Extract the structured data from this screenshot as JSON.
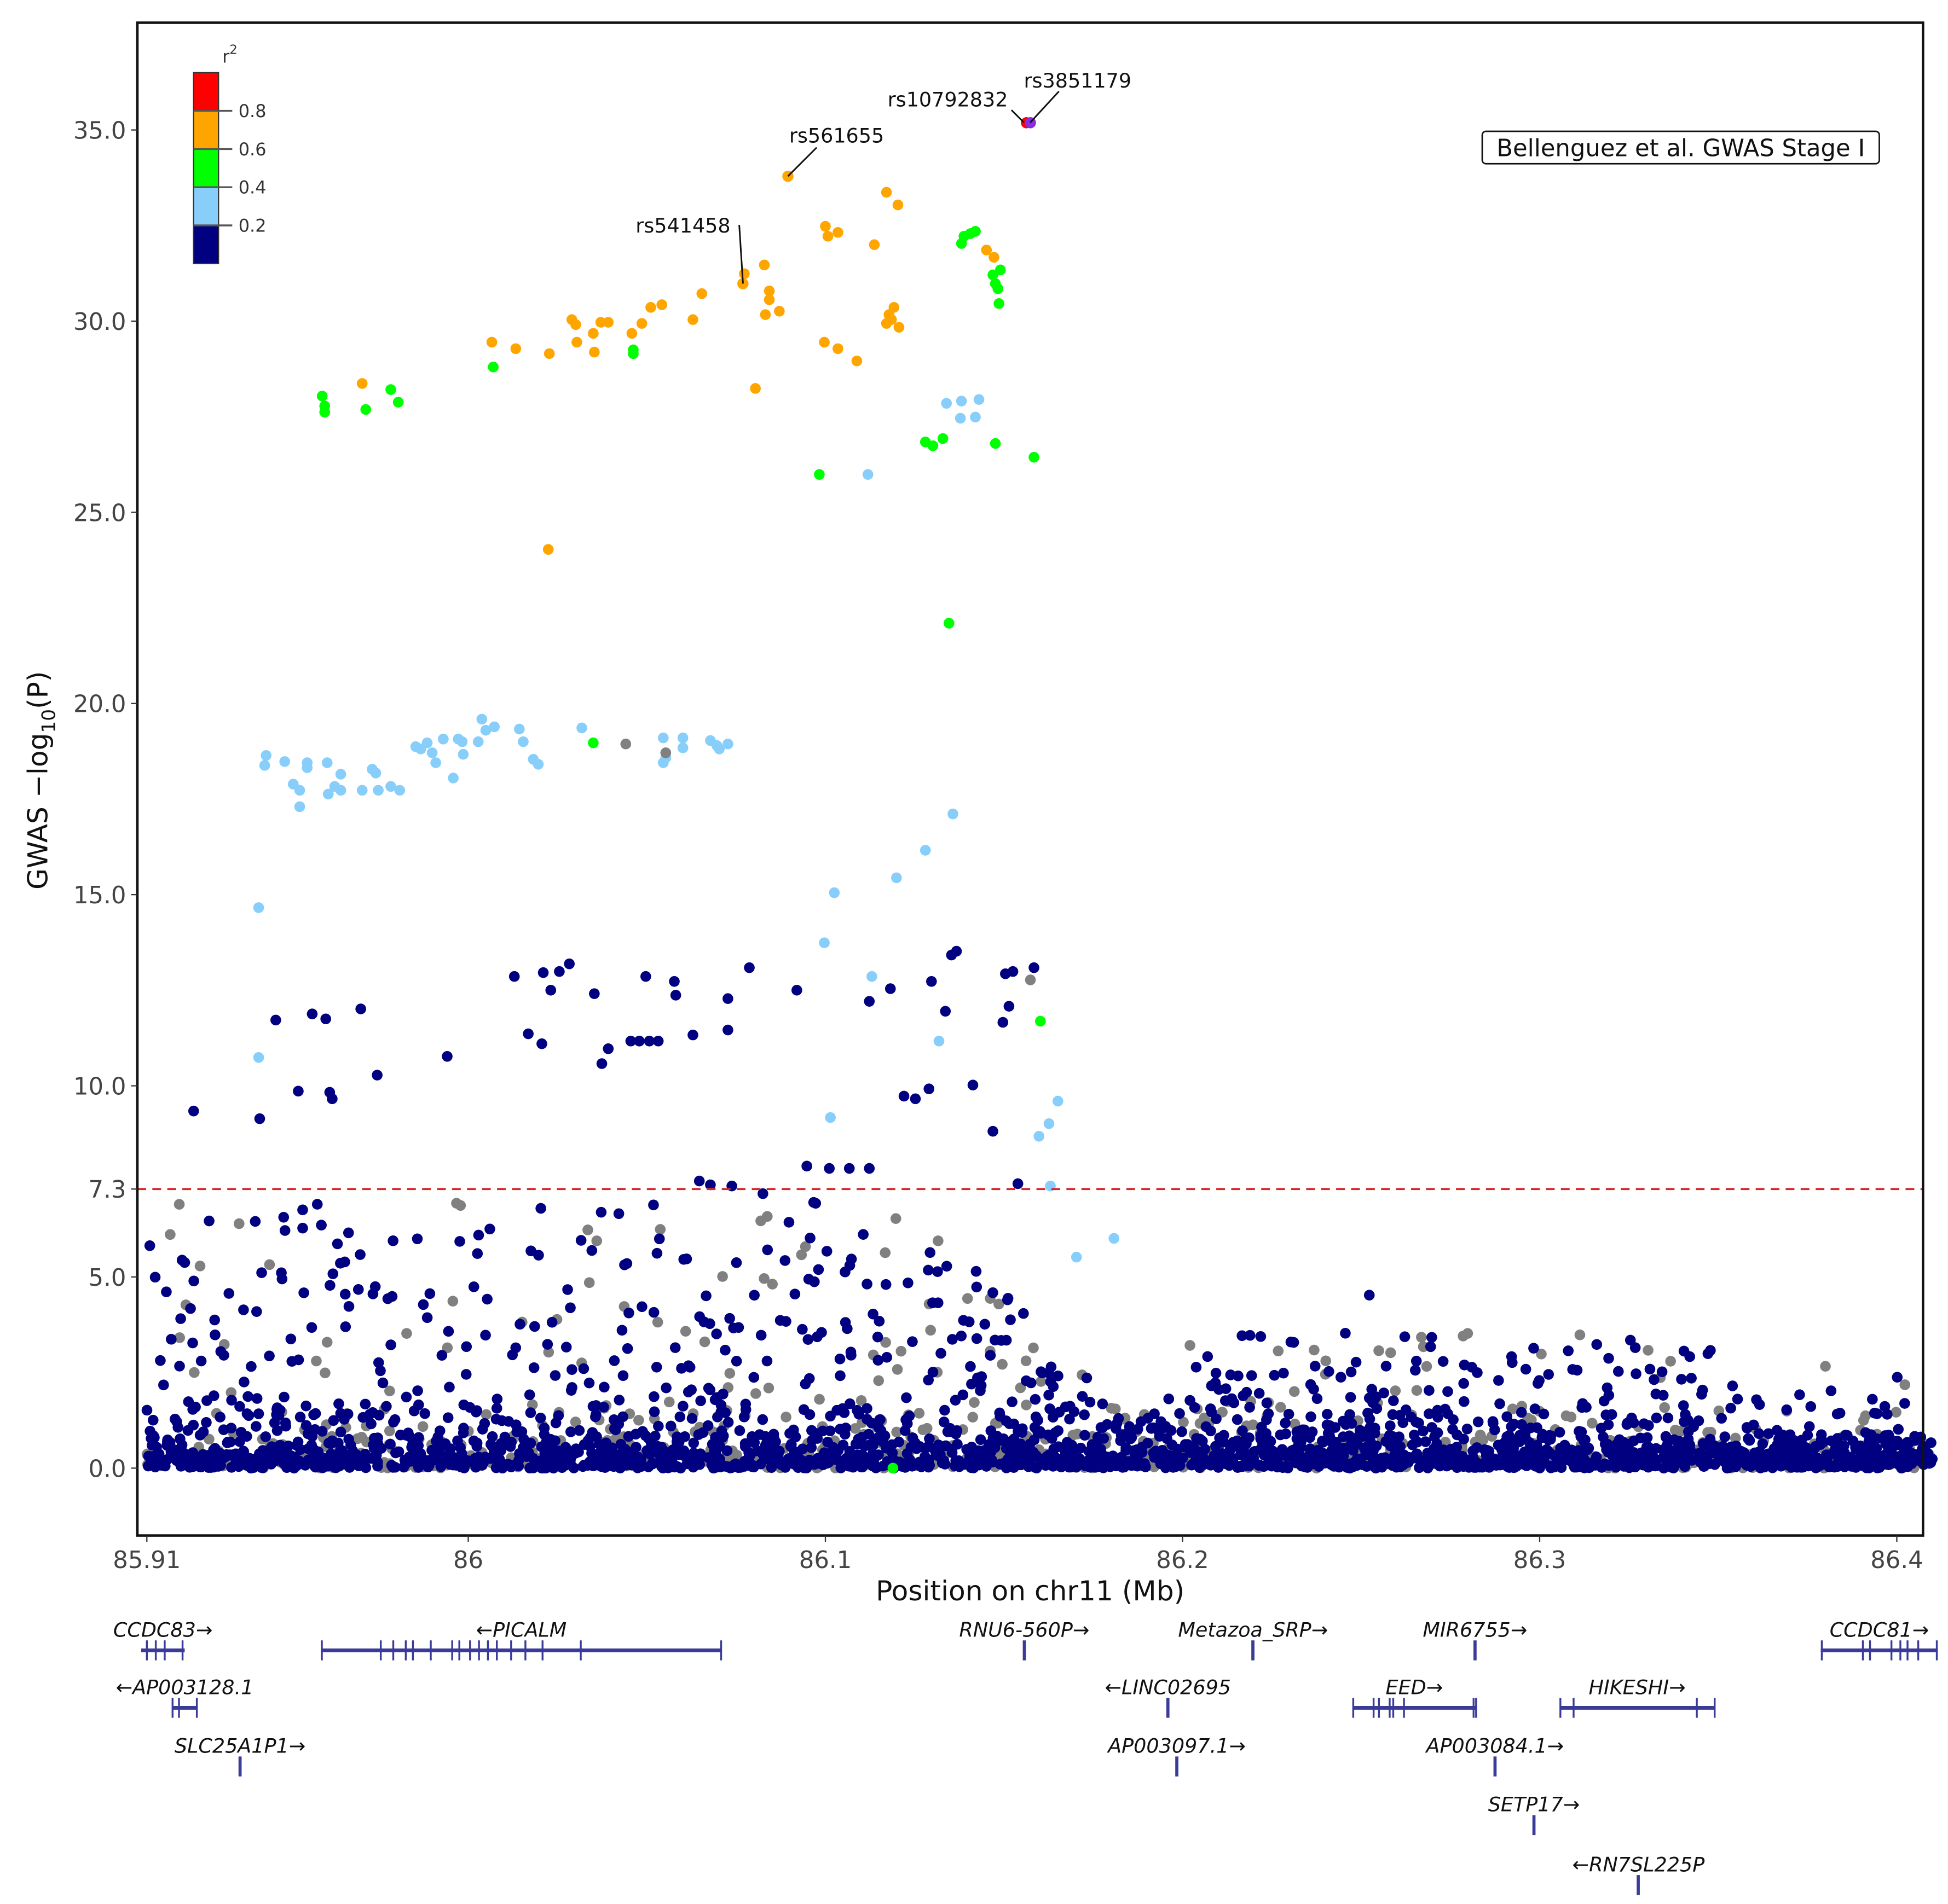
{
  "chart_data": {
    "type": "scatter",
    "title": "",
    "xlabel": "Position on chr11 (Mb)",
    "ylabel": "GWAS −log10(P)",
    "ylabel_parts": {
      "main": "GWAS −log",
      "sub": "10",
      "tail": "(P)"
    },
    "xlim": [
      85.91,
      86.41
    ],
    "ylim": [
      -1.8,
      37.8
    ],
    "xticks": [
      "85.91",
      "86",
      "86.1",
      "86.2",
      "86.3",
      "86.4"
    ],
    "xtick_values": [
      85.91,
      86.0,
      86.1,
      86.2,
      86.3,
      86.4
    ],
    "yticks": [
      "0.0",
      "5.0",
      "7.3",
      "10.0",
      "15.0",
      "20.0",
      "25.0",
      "30.0",
      "35.0"
    ],
    "ytick_values": [
      0,
      5,
      7.3,
      10,
      15,
      20,
      25,
      30,
      35
    ],
    "threshold": {
      "value": 7.3,
      "color": "#d62728"
    },
    "annotation_box": "Bellenguez et al. GWAS Stage I",
    "legend": {
      "title": "r",
      "title_sup": "2",
      "placement": "top-left",
      "bins": [
        {
          "color": "#000080"
        },
        {
          "color": "#87cefa"
        },
        {
          "color": "#00ff00"
        },
        {
          "color": "#ffa500"
        },
        {
          "color": "#ff0000"
        }
      ],
      "tick_labels": [
        "0.2",
        "0.4",
        "0.6",
        "0.8"
      ]
    },
    "colors": {
      "0": "#000080",
      "1": "#87cefa",
      "2": "#00ff00",
      "3": "#ffa500",
      "4": "#ff0000",
      "lead": "#8a2be2",
      "na": "#808080"
    },
    "labeled_snps": [
      {
        "name": "rs3851179",
        "x": 86.1574,
        "y": 35.19,
        "color_key": "lead"
      },
      {
        "name": "rs10792832",
        "x": 86.1563,
        "y": 35.19,
        "color_key": "4"
      },
      {
        "name": "rs561655",
        "x": 86.0895,
        "y": 33.79,
        "color_key": "3"
      },
      {
        "name": "rs541458",
        "x": 86.0769,
        "y": 30.98,
        "color_key": "3"
      }
    ],
    "points": [
      [
        86.1171,
        33.37,
        "3"
      ],
      [
        86.1203,
        33.04,
        "3"
      ],
      [
        86.1,
        32.48,
        "3"
      ],
      [
        86.1007,
        32.22,
        "3"
      ],
      [
        86.1035,
        32.32,
        "3"
      ],
      [
        86.1137,
        32.0,
        "3"
      ],
      [
        86.0773,
        31.24,
        "3"
      ],
      [
        86.0829,
        31.47,
        "3"
      ],
      [
        86.0843,
        30.79,
        "3"
      ],
      [
        86.0843,
        30.56,
        "3"
      ],
      [
        86.0832,
        30.17,
        "3"
      ],
      [
        86.0871,
        30.26,
        "3"
      ],
      [
        86.0654,
        30.72,
        "3"
      ],
      [
        86.0542,
        30.43,
        "3"
      ],
      [
        86.0511,
        30.36,
        "3"
      ],
      [
        86.0629,
        30.04,
        "3"
      ],
      [
        86.0486,
        29.94,
        "3"
      ],
      [
        86.0458,
        29.68,
        "3"
      ],
      [
        86.0392,
        29.97,
        "3"
      ],
      [
        86.0371,
        29.97,
        "3"
      ],
      [
        86.029,
        30.04,
        "3"
      ],
      [
        86.0301,
        29.91,
        "3"
      ],
      [
        86.035,
        29.68,
        "3"
      ],
      [
        86.0304,
        29.45,
        "3"
      ],
      [
        86.0353,
        29.19,
        "3"
      ],
      [
        86.0227,
        29.15,
        "3"
      ],
      [
        86.0133,
        29.28,
        "3"
      ],
      [
        86.0066,
        29.45,
        "3"
      ],
      [
        85.9703,
        28.37,
        "3"
      ],
      [
        86.0804,
        28.24,
        "3"
      ],
      [
        86.0997,
        29.45,
        "3"
      ],
      [
        86.1035,
        29.28,
        "3"
      ],
      [
        86.1088,
        28.96,
        "3"
      ],
      [
        86.1178,
        30.17,
        "3"
      ],
      [
        86.1192,
        30.36,
        "3"
      ],
      [
        86.1171,
        29.94,
        "3"
      ],
      [
        86.1206,
        29.84,
        "3"
      ],
      [
        86.1185,
        30.04,
        "3"
      ],
      [
        86.1451,
        31.86,
        "3"
      ],
      [
        86.1472,
        31.67,
        "3"
      ],
      [
        86.0224,
        24.03,
        "3"
      ],
      [
        86.1388,
        32.22,
        "2"
      ],
      [
        86.1381,
        32.03,
        "2"
      ],
      [
        86.142,
        32.35,
        "2"
      ],
      [
        86.1406,
        32.29,
        "2"
      ],
      [
        86.1469,
        31.21,
        "2"
      ],
      [
        86.149,
        31.34,
        "2"
      ],
      [
        86.1476,
        30.98,
        "2"
      ],
      [
        86.1483,
        30.85,
        "2"
      ],
      [
        86.1486,
        30.46,
        "2"
      ],
      [
        86.007,
        28.8,
        "2"
      ],
      [
        86.0462,
        29.25,
        "2"
      ],
      [
        86.0462,
        29.15,
        "2"
      ],
      [
        85.9591,
        28.04,
        "2"
      ],
      [
        85.9598,
        27.78,
        "2"
      ],
      [
        85.9598,
        27.62,
        "2"
      ],
      [
        85.9713,
        27.69,
        "2"
      ],
      [
        85.9783,
        28.21,
        "2"
      ],
      [
        85.9804,
        27.88,
        "2"
      ],
      [
        86.0983,
        25.99,
        "2"
      ],
      [
        86.128,
        26.84,
        "2"
      ],
      [
        86.1301,
        26.74,
        "2"
      ],
      [
        86.1329,
        26.93,
        "2"
      ],
      [
        86.1476,
        26.8,
        "2"
      ],
      [
        86.1584,
        26.44,
        "2"
      ],
      [
        86.1346,
        22.1,
        "2"
      ],
      [
        86.035,
        18.97,
        "2"
      ],
      [
        86.1602,
        11.69,
        "2"
      ],
      [
        86.1189,
        0.0,
        "2"
      ],
      [
        86.1119,
        25.99,
        "1"
      ],
      [
        86.1339,
        27.85,
        "1"
      ],
      [
        86.1381,
        27.91,
        "1"
      ],
      [
        86.143,
        27.95,
        "1"
      ],
      [
        86.1378,
        27.46,
        "1"
      ],
      [
        86.142,
        27.49,
        "1"
      ],
      [
        86.1357,
        17.11,
        "1"
      ],
      [
        86.128,
        16.16,
        "1"
      ],
      [
        86.1199,
        15.44,
        "1"
      ],
      [
        86.1025,
        15.05,
        "1"
      ],
      [
        86.0997,
        13.74,
        "1"
      ],
      [
        86.113,
        12.86,
        "1"
      ],
      [
        86.1318,
        11.17,
        "1"
      ],
      [
        86.1014,
        9.17,
        "1"
      ],
      [
        85.9413,
        14.66,
        "1"
      ],
      [
        85.9413,
        10.74,
        "1"
      ],
      [
        86.1651,
        9.6,
        "1"
      ],
      [
        86.1626,
        9.01,
        "1"
      ],
      [
        86.1598,
        8.68,
        "1"
      ],
      [
        86.163,
        7.38,
        "1"
      ],
      [
        86.1808,
        6.01,
        "1"
      ],
      [
        86.1703,
        5.52,
        "1"
      ],
      [
        85.943,
        18.38,
        "1"
      ],
      [
        85.9434,
        18.64,
        "1"
      ],
      [
        85.9486,
        18.48,
        "1"
      ],
      [
        85.951,
        17.89,
        "1"
      ],
      [
        85.9528,
        17.73,
        "1"
      ],
      [
        85.9528,
        17.3,
        "1"
      ],
      [
        85.9549,
        18.45,
        "1"
      ],
      [
        85.9549,
        18.32,
        "1"
      ],
      [
        85.9605,
        18.45,
        "1"
      ],
      [
        85.9608,
        17.63,
        "1"
      ],
      [
        85.9626,
        17.83,
        "1"
      ],
      [
        85.9643,
        18.15,
        "1"
      ],
      [
        85.9643,
        17.73,
        "1"
      ],
      [
        85.9703,
        17.73,
        "1"
      ],
      [
        85.9731,
        18.28,
        "1"
      ],
      [
        85.9741,
        18.18,
        "1"
      ],
      [
        85.9748,
        17.73,
        "1"
      ],
      [
        85.9783,
        17.83,
        "1"
      ],
      [
        85.9808,
        17.73,
        "1"
      ],
      [
        85.9853,
        18.87,
        "1"
      ],
      [
        85.9867,
        18.81,
        "1"
      ],
      [
        85.9885,
        18.97,
        "1"
      ],
      [
        85.9899,
        18.71,
        "1"
      ],
      [
        85.9909,
        18.45,
        "1"
      ],
      [
        85.993,
        19.07,
        "1"
      ],
      [
        85.9958,
        18.05,
        "1"
      ],
      [
        85.9972,
        19.07,
        "1"
      ],
      [
        85.9983,
        19.0,
        "1"
      ],
      [
        85.9986,
        18.67,
        "1"
      ],
      [
        86.0028,
        19.0,
        "1"
      ],
      [
        86.0038,
        19.59,
        "1"
      ],
      [
        86.0049,
        19.3,
        "1"
      ],
      [
        86.0073,
        19.39,
        "1"
      ],
      [
        86.0143,
        19.33,
        "1"
      ],
      [
        86.0154,
        19.0,
        "1"
      ],
      [
        86.0182,
        18.54,
        "1"
      ],
      [
        86.0196,
        18.41,
        "1"
      ],
      [
        86.0318,
        19.36,
        "1"
      ],
      [
        86.0546,
        19.1,
        "1"
      ],
      [
        86.0553,
        18.58,
        "1"
      ],
      [
        86.0546,
        18.45,
        "1"
      ],
      [
        86.0601,
        19.1,
        "1"
      ],
      [
        86.0601,
        18.84,
        "1"
      ],
      [
        86.0678,
        19.03,
        "1"
      ],
      [
        86.0696,
        18.9,
        "1"
      ],
      [
        86.0703,
        18.81,
        "1"
      ],
      [
        86.0727,
        18.94,
        "1"
      ],
      [
        86.0441,
        18.94,
        "na"
      ],
      [
        86.0553,
        18.71,
        "na"
      ],
      [
        86.1574,
        12.77,
        "na"
      ],
      [
        85.9231,
        9.34,
        "0"
      ],
      [
        85.9416,
        9.14,
        "0"
      ],
      [
        85.9461,
        11.72,
        "0"
      ],
      [
        85.9563,
        11.88,
        "0"
      ],
      [
        85.9601,
        11.75,
        "0"
      ],
      [
        85.9524,
        9.86,
        "0"
      ],
      [
        85.9612,
        9.83,
        "0"
      ],
      [
        85.9619,
        9.66,
        "0"
      ],
      [
        85.9699,
        12.01,
        "0"
      ],
      [
        85.9745,
        10.28,
        "0"
      ],
      [
        85.9941,
        10.77,
        "0"
      ],
      [
        86.0129,
        12.86,
        "0"
      ],
      [
        86.0168,
        11.36,
        "0"
      ],
      [
        86.0206,
        11.1,
        "0"
      ],
      [
        86.021,
        12.96,
        "0"
      ],
      [
        86.0231,
        12.5,
        "0"
      ],
      [
        86.0255,
        12.99,
        "0"
      ],
      [
        86.0283,
        13.19,
        "0"
      ],
      [
        86.0353,
        12.41,
        "0"
      ],
      [
        86.0374,
        10.58,
        "0"
      ],
      [
        86.0392,
        10.97,
        "0"
      ],
      [
        86.0455,
        11.17,
        "0"
      ],
      [
        86.0479,
        11.17,
        "0"
      ],
      [
        86.0507,
        11.17,
        "0"
      ],
      [
        86.0532,
        11.17,
        "0"
      ],
      [
        86.0497,
        12.86,
        "0"
      ],
      [
        86.0577,
        12.73,
        "0"
      ],
      [
        86.0581,
        12.37,
        "0"
      ],
      [
        86.0629,
        11.33,
        "0"
      ],
      [
        86.0727,
        12.28,
        "0"
      ],
      [
        86.0727,
        11.46,
        "0"
      ],
      [
        86.0787,
        13.09,
        "0"
      ],
      [
        86.092,
        12.5,
        "0"
      ],
      [
        86.0948,
        7.9,
        "0"
      ],
      [
        86.1011,
        7.84,
        "0"
      ],
      [
        86.1067,
        7.84,
        "0"
      ],
      [
        86.1123,
        7.84,
        "0"
      ],
      [
        86.0647,
        7.51,
        "0"
      ],
      [
        86.0678,
        7.41,
        "0"
      ],
      [
        86.0738,
        7.38,
        "0"
      ],
      [
        86.0825,
        7.18,
        "0"
      ],
      [
        86.1123,
        12.21,
        "0"
      ],
      [
        86.1182,
        12.54,
        "0"
      ],
      [
        86.122,
        9.73,
        "0"
      ],
      [
        86.1252,
        9.66,
        "0"
      ],
      [
        86.129,
        9.92,
        "0"
      ],
      [
        86.1297,
        12.73,
        "0"
      ],
      [
        86.1336,
        11.95,
        "0"
      ],
      [
        86.1353,
        13.42,
        "0"
      ],
      [
        86.1367,
        13.52,
        "0"
      ],
      [
        86.1413,
        10.02,
        "0"
      ],
      [
        86.1469,
        8.81,
        "0"
      ],
      [
        86.1504,
        12.93,
        "0"
      ],
      [
        86.1525,
        12.99,
        "0"
      ],
      [
        86.1514,
        12.08,
        "0"
      ],
      [
        86.1497,
        11.66,
        "0"
      ],
      [
        86.1584,
        13.09,
        "0"
      ],
      [
        86.1539,
        7.44,
        "0"
      ]
    ],
    "background_points": {
      "count": 3200,
      "seed": 11,
      "colors": [
        "0",
        "na"
      ],
      "gray_fraction": 0.22,
      "elevated_region": [
        85.91,
        86.19
      ],
      "elevated_max": 7.0,
      "secondary_region": [
        86.2,
        86.36
      ],
      "secondary_max": 3.6
    }
  },
  "genes": [
    {
      "label": "CCDC83→",
      "start": 85.9084,
      "end": 85.9206,
      "row": 0,
      "exons": [
        85.91,
        85.9125,
        85.915,
        85.92
      ]
    },
    {
      "label": "←PICALM",
      "start": 85.9587,
      "end": 86.071,
      "row": 0,
      "exons": [
        85.959,
        85.9755,
        85.979,
        85.9825,
        85.9845,
        85.9895,
        85.9955,
        85.9975,
        86.0005,
        86.003,
        86.0055,
        86.008,
        86.012,
        86.016,
        86.0208,
        86.0315,
        86.0708
      ]
    },
    {
      "label": "RNU6-560P→",
      "start": 86.1556,
      "end": 86.1558,
      "row": 0,
      "exons": [
        86.1557
      ]
    },
    {
      "label": "Metazoa_SRP→",
      "start": 86.2196,
      "end": 86.2199,
      "row": 0,
      "exons": [
        86.2197
      ]
    },
    {
      "label": "MIR6755→",
      "start": 86.2818,
      "end": 86.282,
      "row": 0,
      "exons": [
        86.2819
      ]
    },
    {
      "label": "CCDC81→",
      "start": 86.3787,
      "end": 86.4115,
      "row": 0,
      "exons": [
        86.379,
        86.3905,
        86.3925,
        86.3985,
        86.401,
        86.403,
        86.406,
        86.4112
      ]
    },
    {
      "label": "←AP003128.1",
      "start": 85.9171,
      "end": 85.9241,
      "row": 1,
      "exons": [
        85.9172,
        85.919,
        85.924
      ]
    },
    {
      "label": "←LINC02695",
      "start": 86.1958,
      "end": 86.196,
      "row": 1,
      "exons": [
        86.1959
      ]
    },
    {
      "label": "EED→",
      "start": 86.2476,
      "end": 86.2822,
      "row": 1,
      "exons": [
        86.2478,
        86.2535,
        86.255,
        86.258,
        86.259,
        86.262,
        86.2815,
        86.2822
      ]
    },
    {
      "label": "HIKESHI→",
      "start": 86.3056,
      "end": 86.349,
      "row": 1,
      "exons": [
        86.3058,
        86.3095,
        86.344,
        86.349
      ]
    },
    {
      "label": "SLC25A1P1→",
      "start": 85.936,
      "end": 85.9362,
      "row": 2,
      "exons": [
        85.9361
      ]
    },
    {
      "label": "AP003097.1→",
      "start": 86.1983,
      "end": 86.1985,
      "row": 2,
      "exons": [
        86.1984
      ]
    },
    {
      "label": "AP003084.1→",
      "start": 86.2874,
      "end": 86.2876,
      "row": 2,
      "exons": [
        86.2875
      ]
    },
    {
      "label": "SETP17→",
      "start": 86.2983,
      "end": 86.2985,
      "row": 3,
      "exons": [
        86.2984
      ]
    },
    {
      "label": "←RN7SL225P",
      "start": 86.3276,
      "end": 86.3277,
      "row": 4,
      "exons": [
        86.3276
      ]
    }
  ]
}
